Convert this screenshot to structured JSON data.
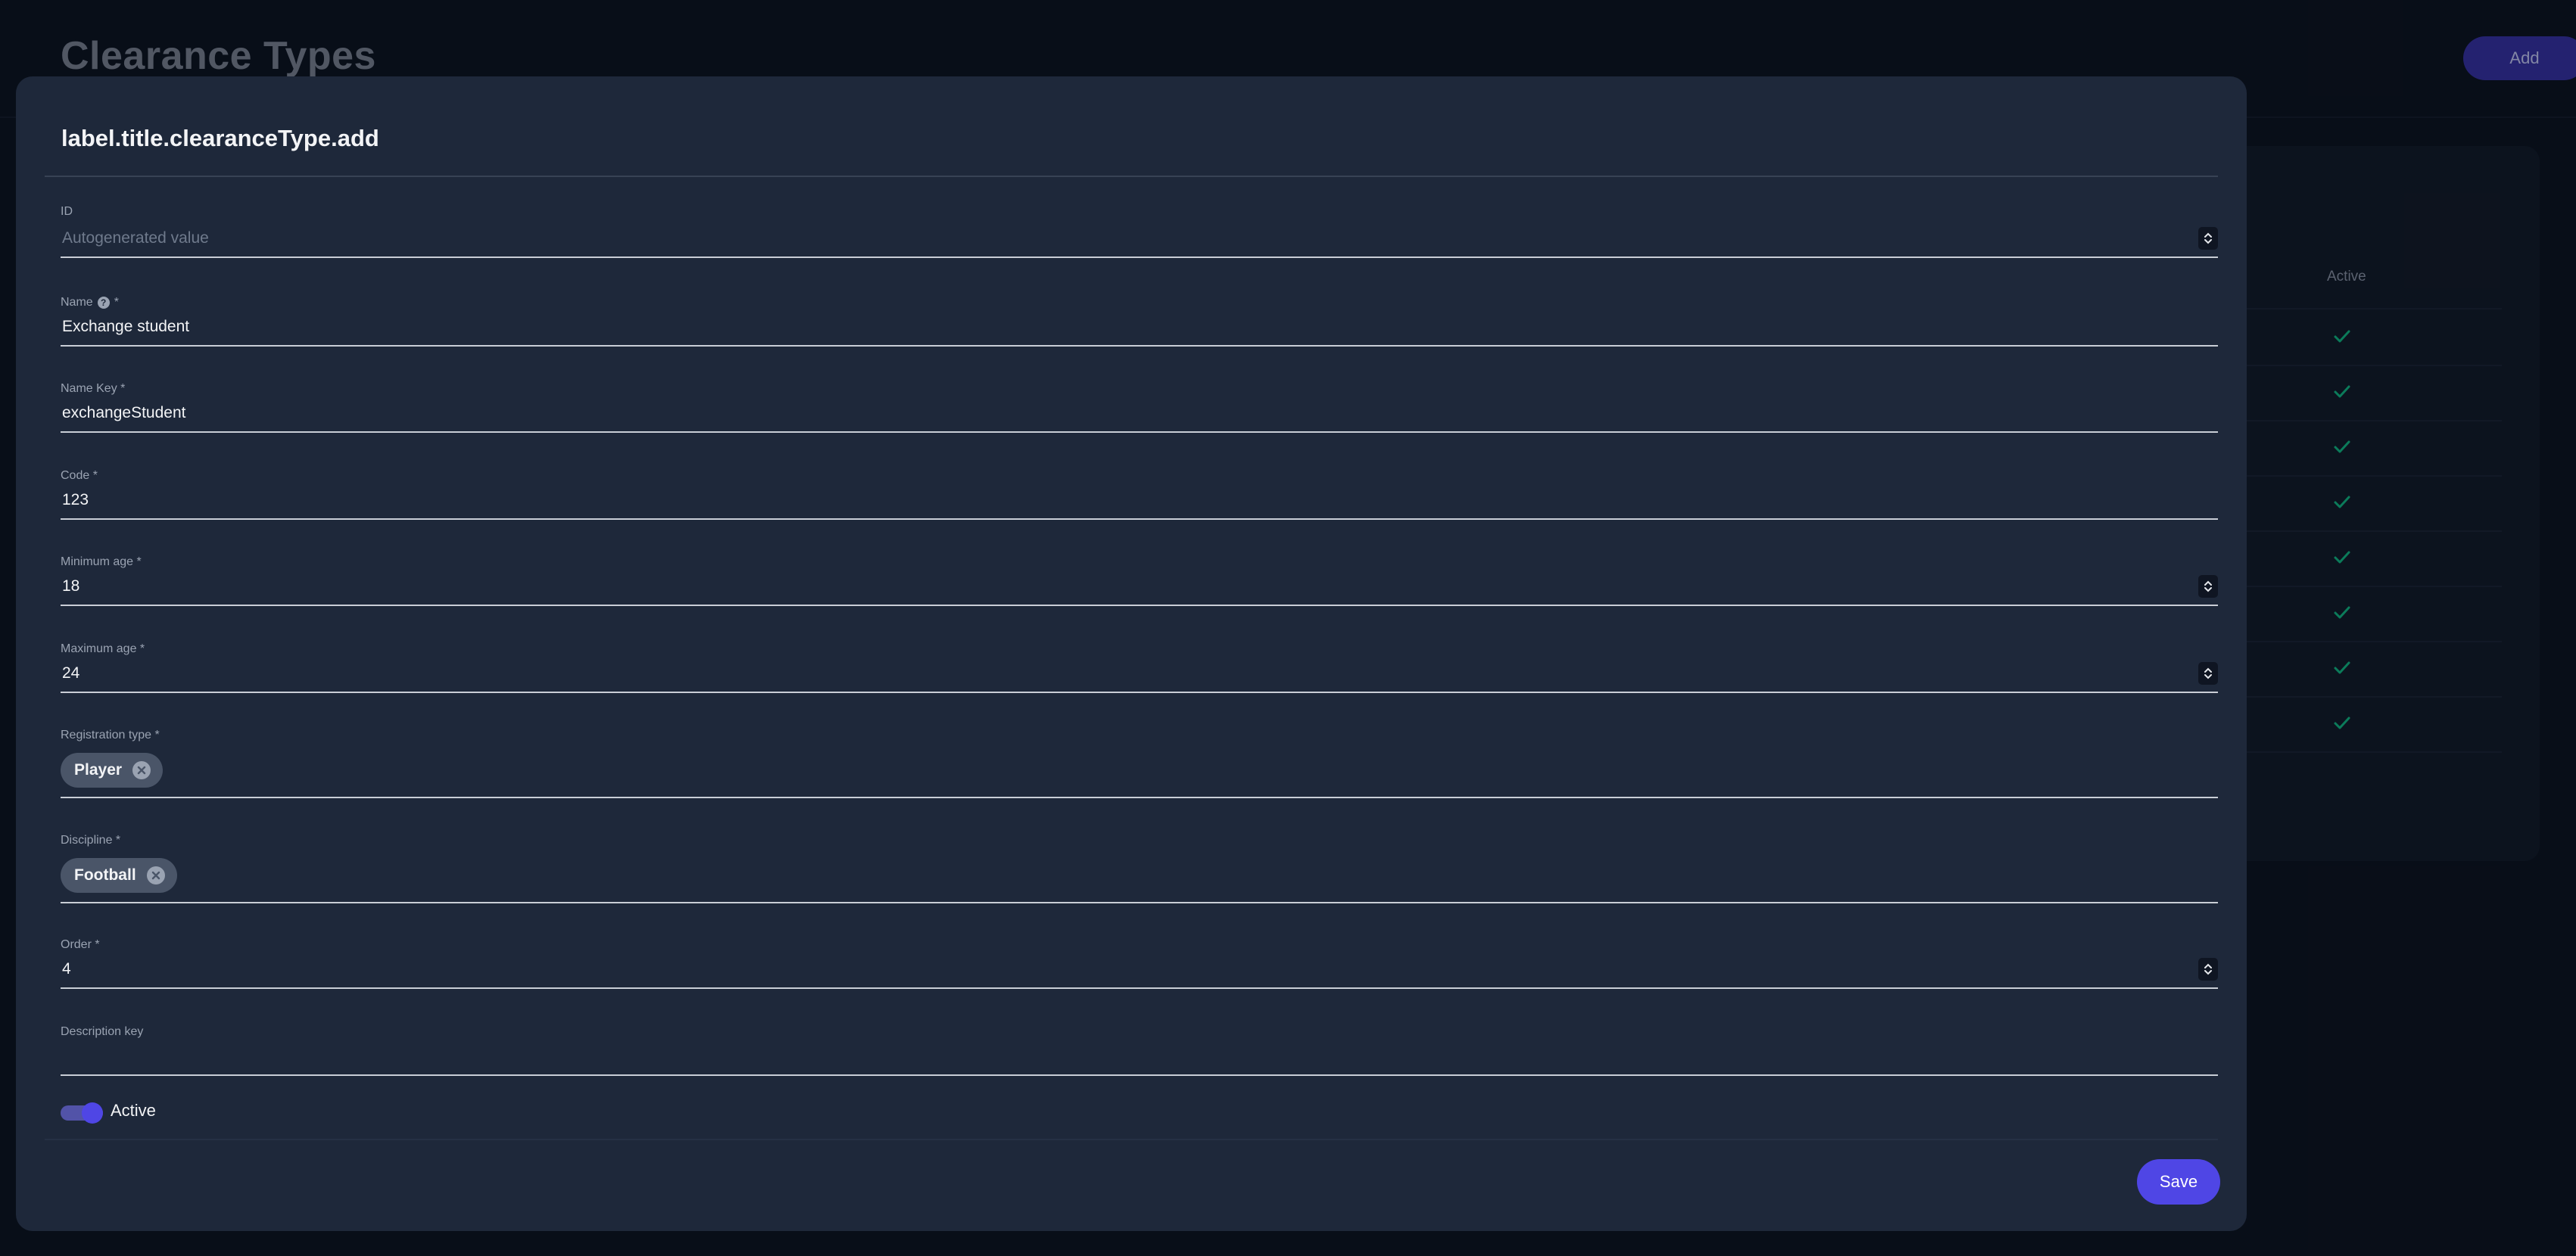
{
  "page": {
    "title": "Clearance Types",
    "add_label": "Add",
    "table": {
      "column_active": "Active",
      "rows": [
        {
          "active": true
        },
        {
          "active": true
        },
        {
          "active": true
        },
        {
          "active": true
        },
        {
          "active": true
        },
        {
          "active": true
        },
        {
          "active": true
        },
        {
          "active": true
        }
      ]
    }
  },
  "modal": {
    "title": "label.title.clearanceType.add",
    "fields": {
      "id": {
        "label": "ID",
        "placeholder": "Autogenerated value"
      },
      "name": {
        "label": "Name",
        "required_marker": "*",
        "value": "Exchange student"
      },
      "name_key": {
        "label": "Name Key *",
        "value": "exchangeStudent"
      },
      "code": {
        "label": "Code *",
        "value": "123"
      },
      "min_age": {
        "label": "Minimum age *",
        "value": "18"
      },
      "max_age": {
        "label": "Maximum age *",
        "value": "24"
      },
      "registration_type": {
        "label": "Registration type *",
        "chip": "Player"
      },
      "discipline": {
        "label": "Discipline *",
        "chip": "Football"
      },
      "order": {
        "label": "Order *",
        "value": "4"
      },
      "description_key": {
        "label": "Description key",
        "value": ""
      }
    },
    "active_toggle": {
      "label": "Active",
      "on": true
    },
    "save_label": "Save"
  },
  "icons": {
    "help": "help-circle-icon",
    "stepper": "stepper-arrows-icon",
    "chip_remove": "close-circle-icon",
    "check": "check-icon"
  },
  "colors": {
    "accent": "#4f46e5",
    "check": "#10b981",
    "modal_bg": "#1e283a",
    "page_bg": "#0b111d"
  }
}
